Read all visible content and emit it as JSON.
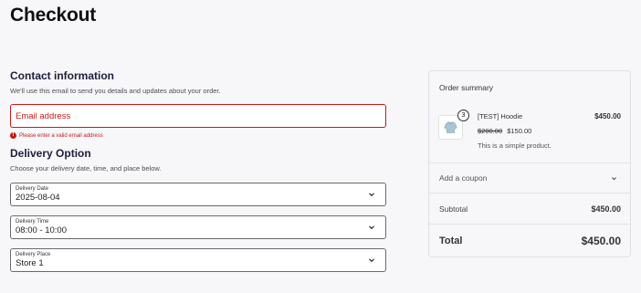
{
  "page": {
    "title": "Checkout"
  },
  "contact": {
    "heading": "Contact information",
    "description": "We'll use this email to send you details and updates about your order.",
    "email_placeholder": "Email address",
    "error": "Please enter a valid email address"
  },
  "delivery": {
    "heading": "Delivery Option",
    "description": "Choose your delivery date, time, and place below.",
    "fields": [
      {
        "label": "Delivery Date",
        "value": "2025-08-04"
      },
      {
        "label": "Delivery Time",
        "value": "08:00 - 10:00"
      },
      {
        "label": "Delivery Place",
        "value": "Store 1"
      }
    ]
  },
  "summary": {
    "title": "Order summary",
    "item": {
      "quantity": "3",
      "name": "[TEST] Hoodie",
      "line_total": "$450.00",
      "regular_price": "$200.00",
      "sale_price": "$150.00",
      "description": "This is a simple product."
    },
    "coupon_label": "Add a coupon",
    "subtotal_label": "Subtotal",
    "subtotal_value": "$450.00",
    "total_label": "Total",
    "total_value": "$450.00"
  },
  "icons": {
    "chevron": "chevron-down-icon",
    "error": "alert-circle-icon",
    "product": "hoodie-thumbnail"
  },
  "colors": {
    "error": "#cc1818",
    "background": "#f7f7f9",
    "text": "#1e1e1e"
  }
}
